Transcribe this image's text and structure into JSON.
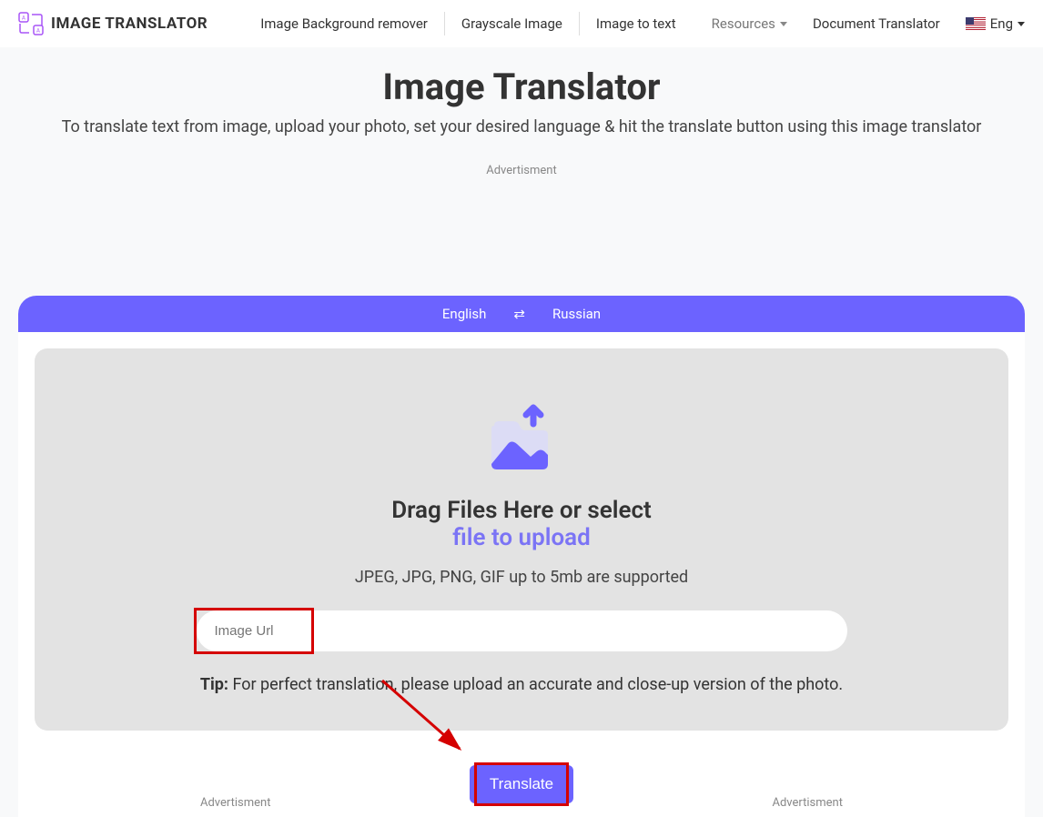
{
  "header": {
    "logo_text": "IMAGE TRANSLATOR",
    "nav": [
      "Image Background remover",
      "Grayscale Image",
      "Image to text"
    ],
    "resources": "Resources",
    "doc_translator": "Document Translator",
    "lang_label": "Eng"
  },
  "hero": {
    "title": "Image Translator",
    "subtitle": "To translate text from image, upload your photo, set your desired language & hit the translate button using this image translator",
    "ad": "Advertisment"
  },
  "lang_bar": {
    "source": "English",
    "target": "Russian"
  },
  "upload": {
    "drag_title": "Drag Files Here or select",
    "file_link": "file to upload",
    "formats": "JPEG, JPG, PNG, GIF up to 5mb are supported",
    "url_placeholder": "Image Url",
    "tip_label": "Tip:",
    "tip_text": " For perfect translation, please upload an accurate and close-up version of the photo."
  },
  "translate": {
    "button": "Translate",
    "ad_left": "Advertisment",
    "ad_right": "Advertisment"
  }
}
